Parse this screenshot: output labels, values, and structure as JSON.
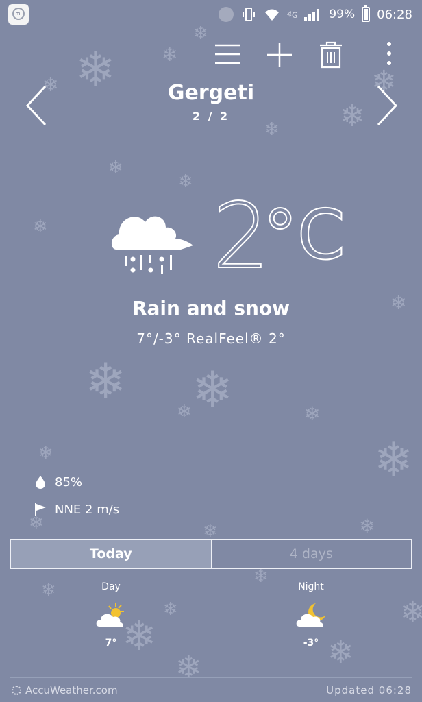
{
  "status_bar": {
    "battery_percent": "99%",
    "time": "06:28",
    "network": "4G"
  },
  "toolbar": {
    "icons": [
      "menu-icon",
      "add-icon",
      "delete-icon",
      "more-icon"
    ]
  },
  "location": {
    "city": "Gergeti",
    "page": "2 / 2"
  },
  "current": {
    "icon": "rain-and-snow-icon",
    "temperature": "2",
    "unit": "°C",
    "condition": "Rain and snow",
    "hi_lo_realfeel": "7°/-3° RealFeel® 2°",
    "humidity": "85%",
    "wind": "NNE 2 m/s"
  },
  "tabs": [
    {
      "label": "Today",
      "active": true
    },
    {
      "label": "4 days",
      "active": false
    }
  ],
  "forecast": {
    "day": {
      "label": "Day",
      "icon": "partly-sunny-icon",
      "temp": "7°"
    },
    "night": {
      "label": "Night",
      "icon": "partly-cloudy-night-icon",
      "temp": "-3°"
    }
  },
  "footer": {
    "brand": "AccuWeather.com",
    "updated": "Updated 06:28"
  },
  "colors": {
    "background": "#8089a4",
    "accent_sun": "#f2c230",
    "text": "#ffffff"
  }
}
